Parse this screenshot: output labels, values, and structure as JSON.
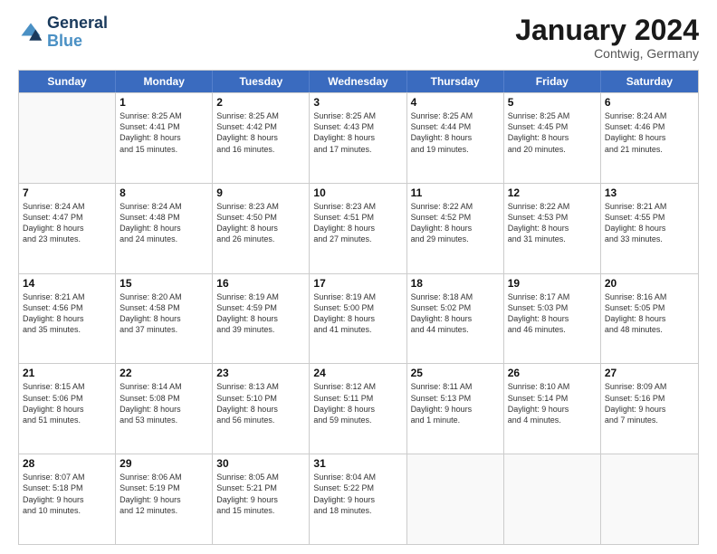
{
  "header": {
    "logo_line1": "General",
    "logo_line2": "Blue",
    "month": "January 2024",
    "location": "Contwig, Germany"
  },
  "weekdays": [
    "Sunday",
    "Monday",
    "Tuesday",
    "Wednesday",
    "Thursday",
    "Friday",
    "Saturday"
  ],
  "weeks": [
    [
      {
        "day": "",
        "info": ""
      },
      {
        "day": "1",
        "info": "Sunrise: 8:25 AM\nSunset: 4:41 PM\nDaylight: 8 hours\nand 15 minutes."
      },
      {
        "day": "2",
        "info": "Sunrise: 8:25 AM\nSunset: 4:42 PM\nDaylight: 8 hours\nand 16 minutes."
      },
      {
        "day": "3",
        "info": "Sunrise: 8:25 AM\nSunset: 4:43 PM\nDaylight: 8 hours\nand 17 minutes."
      },
      {
        "day": "4",
        "info": "Sunrise: 8:25 AM\nSunset: 4:44 PM\nDaylight: 8 hours\nand 19 minutes."
      },
      {
        "day": "5",
        "info": "Sunrise: 8:25 AM\nSunset: 4:45 PM\nDaylight: 8 hours\nand 20 minutes."
      },
      {
        "day": "6",
        "info": "Sunrise: 8:24 AM\nSunset: 4:46 PM\nDaylight: 8 hours\nand 21 minutes."
      }
    ],
    [
      {
        "day": "7",
        "info": "Sunrise: 8:24 AM\nSunset: 4:47 PM\nDaylight: 8 hours\nand 23 minutes."
      },
      {
        "day": "8",
        "info": "Sunrise: 8:24 AM\nSunset: 4:48 PM\nDaylight: 8 hours\nand 24 minutes."
      },
      {
        "day": "9",
        "info": "Sunrise: 8:23 AM\nSunset: 4:50 PM\nDaylight: 8 hours\nand 26 minutes."
      },
      {
        "day": "10",
        "info": "Sunrise: 8:23 AM\nSunset: 4:51 PM\nDaylight: 8 hours\nand 27 minutes."
      },
      {
        "day": "11",
        "info": "Sunrise: 8:22 AM\nSunset: 4:52 PM\nDaylight: 8 hours\nand 29 minutes."
      },
      {
        "day": "12",
        "info": "Sunrise: 8:22 AM\nSunset: 4:53 PM\nDaylight: 8 hours\nand 31 minutes."
      },
      {
        "day": "13",
        "info": "Sunrise: 8:21 AM\nSunset: 4:55 PM\nDaylight: 8 hours\nand 33 minutes."
      }
    ],
    [
      {
        "day": "14",
        "info": "Sunrise: 8:21 AM\nSunset: 4:56 PM\nDaylight: 8 hours\nand 35 minutes."
      },
      {
        "day": "15",
        "info": "Sunrise: 8:20 AM\nSunset: 4:58 PM\nDaylight: 8 hours\nand 37 minutes."
      },
      {
        "day": "16",
        "info": "Sunrise: 8:19 AM\nSunset: 4:59 PM\nDaylight: 8 hours\nand 39 minutes."
      },
      {
        "day": "17",
        "info": "Sunrise: 8:19 AM\nSunset: 5:00 PM\nDaylight: 8 hours\nand 41 minutes."
      },
      {
        "day": "18",
        "info": "Sunrise: 8:18 AM\nSunset: 5:02 PM\nDaylight: 8 hours\nand 44 minutes."
      },
      {
        "day": "19",
        "info": "Sunrise: 8:17 AM\nSunset: 5:03 PM\nDaylight: 8 hours\nand 46 minutes."
      },
      {
        "day": "20",
        "info": "Sunrise: 8:16 AM\nSunset: 5:05 PM\nDaylight: 8 hours\nand 48 minutes."
      }
    ],
    [
      {
        "day": "21",
        "info": "Sunrise: 8:15 AM\nSunset: 5:06 PM\nDaylight: 8 hours\nand 51 minutes."
      },
      {
        "day": "22",
        "info": "Sunrise: 8:14 AM\nSunset: 5:08 PM\nDaylight: 8 hours\nand 53 minutes."
      },
      {
        "day": "23",
        "info": "Sunrise: 8:13 AM\nSunset: 5:10 PM\nDaylight: 8 hours\nand 56 minutes."
      },
      {
        "day": "24",
        "info": "Sunrise: 8:12 AM\nSunset: 5:11 PM\nDaylight: 8 hours\nand 59 minutes."
      },
      {
        "day": "25",
        "info": "Sunrise: 8:11 AM\nSunset: 5:13 PM\nDaylight: 9 hours\nand 1 minute."
      },
      {
        "day": "26",
        "info": "Sunrise: 8:10 AM\nSunset: 5:14 PM\nDaylight: 9 hours\nand 4 minutes."
      },
      {
        "day": "27",
        "info": "Sunrise: 8:09 AM\nSunset: 5:16 PM\nDaylight: 9 hours\nand 7 minutes."
      }
    ],
    [
      {
        "day": "28",
        "info": "Sunrise: 8:07 AM\nSunset: 5:18 PM\nDaylight: 9 hours\nand 10 minutes."
      },
      {
        "day": "29",
        "info": "Sunrise: 8:06 AM\nSunset: 5:19 PM\nDaylight: 9 hours\nand 12 minutes."
      },
      {
        "day": "30",
        "info": "Sunrise: 8:05 AM\nSunset: 5:21 PM\nDaylight: 9 hours\nand 15 minutes."
      },
      {
        "day": "31",
        "info": "Sunrise: 8:04 AM\nSunset: 5:22 PM\nDaylight: 9 hours\nand 18 minutes."
      },
      {
        "day": "",
        "info": ""
      },
      {
        "day": "",
        "info": ""
      },
      {
        "day": "",
        "info": ""
      }
    ]
  ]
}
